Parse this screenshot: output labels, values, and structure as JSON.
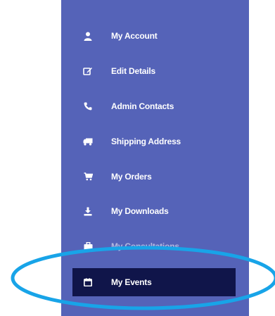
{
  "menu": {
    "items": [
      {
        "label": "My Account",
        "icon": "user-icon"
      },
      {
        "label": "Edit Details",
        "icon": "edit-icon"
      },
      {
        "label": "Admin Contacts",
        "icon": "phone-icon"
      },
      {
        "label": "Shipping Address",
        "icon": "truck-icon"
      },
      {
        "label": "My Orders",
        "icon": "cart-icon"
      },
      {
        "label": "My Downloads",
        "icon": "download-icon"
      },
      {
        "label": "My Consultations",
        "icon": "briefcase-icon"
      },
      {
        "label": "My Events",
        "icon": "calendar-icon",
        "active": true
      }
    ]
  },
  "colors": {
    "panel": "#5563b8",
    "active": "#10154a",
    "highlight": "#18a4e8",
    "text": "#ffffff"
  }
}
